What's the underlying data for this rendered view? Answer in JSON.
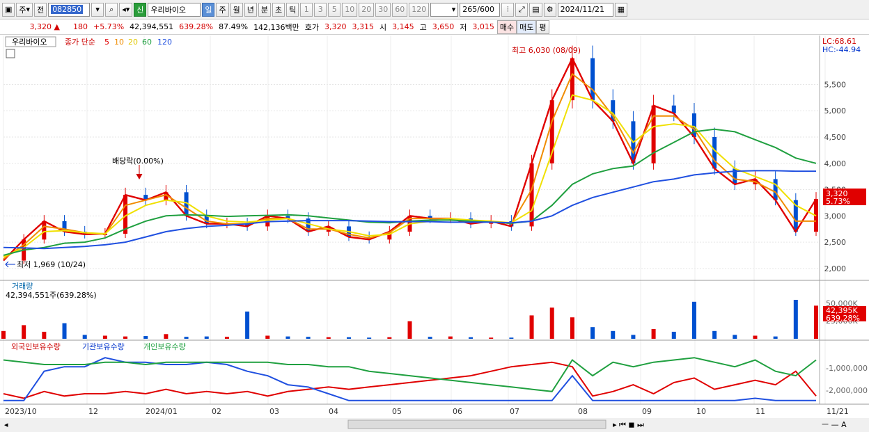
{
  "toolbar": {
    "market": "주",
    "prev": "전",
    "code": "082850",
    "name": "우리바이오",
    "periods": [
      "일",
      "주",
      "월",
      "년",
      "분",
      "초",
      "틱"
    ],
    "intervals": [
      "1",
      "3",
      "5",
      "10",
      "20",
      "30",
      "60",
      "120"
    ],
    "count_shown": "265",
    "count_total": "/600",
    "date": "2024/11/21",
    "sel_badge": "신"
  },
  "quote": {
    "price": "3,320",
    "arrow": "▲",
    "change": "180",
    "change_pct": "+5.73%",
    "volume": "42,394,551",
    "vol_ratio": "639.28%",
    "rate": "87.49%",
    "amount": "142,136백만",
    "hoga_label": "호가",
    "hoga_price": "3,320",
    "bid": "3,315",
    "open_label": "시",
    "open": "3,145",
    "high_label": "고",
    "high": "3,650",
    "low_label": "저",
    "low": "3,015",
    "buy": "매수",
    "sell": "매도",
    "eval": "평"
  },
  "legend": {
    "name": "우리바이오",
    "ma_title": "종가 단순",
    "ma_periods": [
      "5",
      "10",
      "20",
      "60",
      "120"
    ],
    "lc": "LC:68.61",
    "hc": "HC:-44.94"
  },
  "annotations": {
    "high": "최고 6,030 (08/09)",
    "low": "최저 1,969 (10/24)",
    "dividend": "배당락(0.00%)"
  },
  "price_tag": {
    "price": "3,320",
    "pct": "5.73%"
  },
  "volume_panel": {
    "title": "거래량",
    "value": "42,394,551주(639.28%)",
    "tag": "42,395K",
    "tag_pct": "639.28%",
    "ticks": [
      "50,000K",
      "25,000K"
    ]
  },
  "holdings_panel": {
    "labels": [
      "외국인보유수량",
      "기관보유수량",
      "개인보유수량"
    ],
    "ticks": [
      "-1,000,000",
      "-2,000,000"
    ]
  },
  "colors": {
    "ma5": "#e00000",
    "ma10": "#f08c00",
    "ma20": "#f0e000",
    "ma60": "#20a040",
    "ma120": "#2050e0",
    "up": "#e00000",
    "down": "#0050d0"
  },
  "chart_data": [
    {
      "type": "line",
      "title": "우리바이오",
      "ylim": [
        1800,
        6300
      ],
      "yticks": [
        2000,
        2500,
        3000,
        3500,
        4000,
        4500,
        5000,
        5500
      ],
      "x": [
        "2023/10",
        "12",
        "2024/01",
        "02",
        "03",
        "04",
        "05",
        "06",
        "07",
        "08",
        "09",
        "10",
        "11",
        "11/21"
      ],
      "series": [
        {
          "name": "5",
          "values": [
            2150,
            2550,
            2900,
            2700,
            2650,
            2660,
            3400,
            3300,
            3450,
            3000,
            2850,
            2850,
            2800,
            3000,
            2950,
            2700,
            2800,
            2600,
            2550,
            2700,
            3000,
            2950,
            2950,
            2850,
            2900,
            2800,
            4000,
            5200,
            6000,
            5200,
            4800,
            4000,
            5100,
            4950,
            4500,
            3900,
            3600,
            3700,
            3300,
            2700,
            3320
          ]
        },
        {
          "name": "10",
          "values": [
            2180,
            2450,
            2800,
            2750,
            2680,
            2650,
            3200,
            3300,
            3400,
            3150,
            2900,
            2850,
            2850,
            2950,
            2950,
            2750,
            2750,
            2650,
            2580,
            2680,
            2950,
            2950,
            2950,
            2900,
            2900,
            2850,
            3500,
            4800,
            5700,
            5400,
            4900,
            4200,
            4900,
            4900,
            4650,
            4050,
            3700,
            3650,
            3450,
            2900,
            2900
          ]
        },
        {
          "name": "20",
          "values": [
            2220,
            2400,
            2700,
            2720,
            2680,
            2660,
            3000,
            3200,
            3300,
            3250,
            3000,
            2900,
            2880,
            2920,
            2950,
            2850,
            2750,
            2700,
            2620,
            2650,
            2850,
            2900,
            2950,
            2920,
            2900,
            2870,
            3100,
            4200,
            5300,
            5200,
            4950,
            4400,
            4700,
            4750,
            4700,
            4250,
            3900,
            3750,
            3600,
            3200,
            3000
          ]
        },
        {
          "name": "60",
          "values": [
            2250,
            2350,
            2400,
            2480,
            2500,
            2580,
            2750,
            2900,
            3000,
            3020,
            3010,
            2990,
            3000,
            3010,
            3020,
            3000,
            2960,
            2920,
            2880,
            2870,
            2900,
            2920,
            2920,
            2900,
            2880,
            2860,
            2900,
            3200,
            3600,
            3800,
            3900,
            3950,
            4200,
            4400,
            4600,
            4650,
            4600,
            4450,
            4300,
            4100,
            4000
          ]
        },
        {
          "name": "120",
          "values": [
            2400,
            2390,
            2380,
            2400,
            2420,
            2450,
            2500,
            2600,
            2700,
            2760,
            2800,
            2820,
            2850,
            2890,
            2900,
            2910,
            2910,
            2910,
            2900,
            2890,
            2890,
            2890,
            2880,
            2880,
            2880,
            2870,
            2900,
            3000,
            3200,
            3350,
            3450,
            3550,
            3650,
            3700,
            3780,
            3820,
            3850,
            3860,
            3860,
            3850,
            3850
          ]
        }
      ]
    },
    {
      "type": "bar",
      "title": "거래량",
      "values": [
        20,
        35,
        18,
        40,
        10,
        8,
        6,
        7,
        12,
        5,
        6,
        5,
        70,
        8,
        6,
        5,
        4,
        4,
        3,
        4,
        45,
        5,
        6,
        4,
        3,
        3,
        60,
        80,
        55,
        30,
        20,
        10,
        25,
        18,
        95,
        20,
        10,
        8,
        6,
        100,
        85
      ]
    },
    {
      "type": "line",
      "title": "보유수량",
      "series": [
        {
          "name": "외국인보유수량",
          "values": [
            -2.2,
            -2.4,
            -2.1,
            -2.3,
            -2.2,
            -2.2,
            -2.1,
            -2.2,
            -2.0,
            -2.2,
            -2.1,
            -2.2,
            -2.1,
            -2.3,
            -2.1,
            -2.0,
            -1.9,
            -2.0,
            -1.9,
            -1.8,
            -1.7,
            -1.6,
            -1.5,
            -1.4,
            -1.2,
            -1.0,
            -0.9,
            -0.8,
            -1.0,
            -2.3,
            -2.1,
            -1.8,
            -2.2,
            -1.7,
            -1.5,
            -2.0,
            -1.8,
            -1.6,
            -1.8,
            -1.2,
            -2.3
          ]
        },
        {
          "name": "기관보유수량",
          "values": [
            -2.5,
            -2.5,
            -1.2,
            -1.0,
            -1.0,
            -0.6,
            -0.8,
            -0.8,
            -0.9,
            -0.9,
            -0.8,
            -0.9,
            -1.2,
            -1.4,
            -1.8,
            -1.9,
            -2.2,
            -2.5,
            -2.5,
            -2.5,
            -2.5,
            -2.5,
            -2.5,
            -2.5,
            -2.5,
            -2.5,
            -2.5,
            -2.5,
            -1.4,
            -2.5,
            -2.5,
            -2.5,
            -2.5,
            -2.5,
            -2.5,
            -2.5,
            -2.5,
            -2.4,
            -2.5,
            -2.5,
            -2.5
          ]
        },
        {
          "name": "개인보유수량",
          "values": [
            -0.7,
            -0.8,
            -0.9,
            -0.9,
            -0.9,
            -0.8,
            -0.8,
            -0.9,
            -0.8,
            -0.8,
            -0.8,
            -0.8,
            -0.8,
            -0.8,
            -0.9,
            -0.9,
            -1.0,
            -1.0,
            -1.2,
            -1.3,
            -1.4,
            -1.5,
            -1.6,
            -1.7,
            -1.8,
            -1.9,
            -2.0,
            -2.1,
            -0.7,
            -1.4,
            -0.8,
            -1.0,
            -0.8,
            -0.7,
            -0.6,
            -0.8,
            -1.0,
            -0.7,
            -1.2,
            -1.4,
            -0.7
          ]
        }
      ]
    }
  ]
}
